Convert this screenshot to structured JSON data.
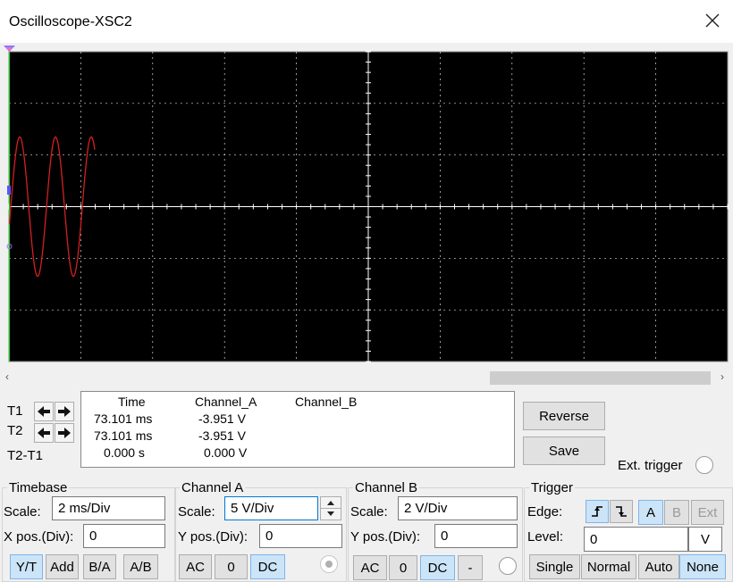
{
  "window": {
    "title": "Oscilloscope-XSC2"
  },
  "readout": {
    "headers": {
      "time": "Time",
      "channel_a": "Channel_A",
      "channel_b": "Channel_B"
    },
    "t1": {
      "label": "T1",
      "time": "73.101 ms",
      "a": "-3.951 V",
      "b": ""
    },
    "t2": {
      "label": "T2",
      "time": "73.101 ms",
      "a": "-3.951 V",
      "b": ""
    },
    "diff": {
      "label": "T2-T1",
      "time": "0.000 s",
      "a": "0.000 V",
      "b": ""
    }
  },
  "buttons": {
    "reverse": "Reverse",
    "save": "Save",
    "ext_trigger": "Ext. trigger"
  },
  "timebase": {
    "title": "Timebase",
    "scale_label": "Scale:",
    "scale_value": "2 ms/Div",
    "xpos_label": "X pos.(Div):",
    "xpos_value": "0",
    "modes": [
      "Y/T",
      "Add",
      "B/A",
      "A/B"
    ]
  },
  "channel_a": {
    "title": "Channel A",
    "scale_label": "Scale:",
    "scale_value": "5  V/Div",
    "ypos_label": "Y pos.(Div):",
    "ypos_value": "0",
    "coupling": [
      "AC",
      "0",
      "DC"
    ]
  },
  "channel_b": {
    "title": "Channel B",
    "scale_label": "Scale:",
    "scale_value": "2  V/Div",
    "ypos_label": "Y pos.(Div):",
    "ypos_value": "0",
    "coupling": [
      "AC",
      "0",
      "DC",
      "-"
    ]
  },
  "trigger": {
    "title": "Trigger",
    "edge_label": "Edge:",
    "level_label": "Level:",
    "level_value": "0",
    "level_unit": "V",
    "sources": [
      "A",
      "B",
      "Ext"
    ],
    "modes": [
      "Single",
      "Normal",
      "Auto",
      "None"
    ]
  },
  "colors": {
    "trace_a": "#d42020",
    "screen": "#000000",
    "grid": "#ffffff",
    "cursor": "#22cc22"
  },
  "scroll_arrows": {
    "left": "‹",
    "right": "›"
  }
}
